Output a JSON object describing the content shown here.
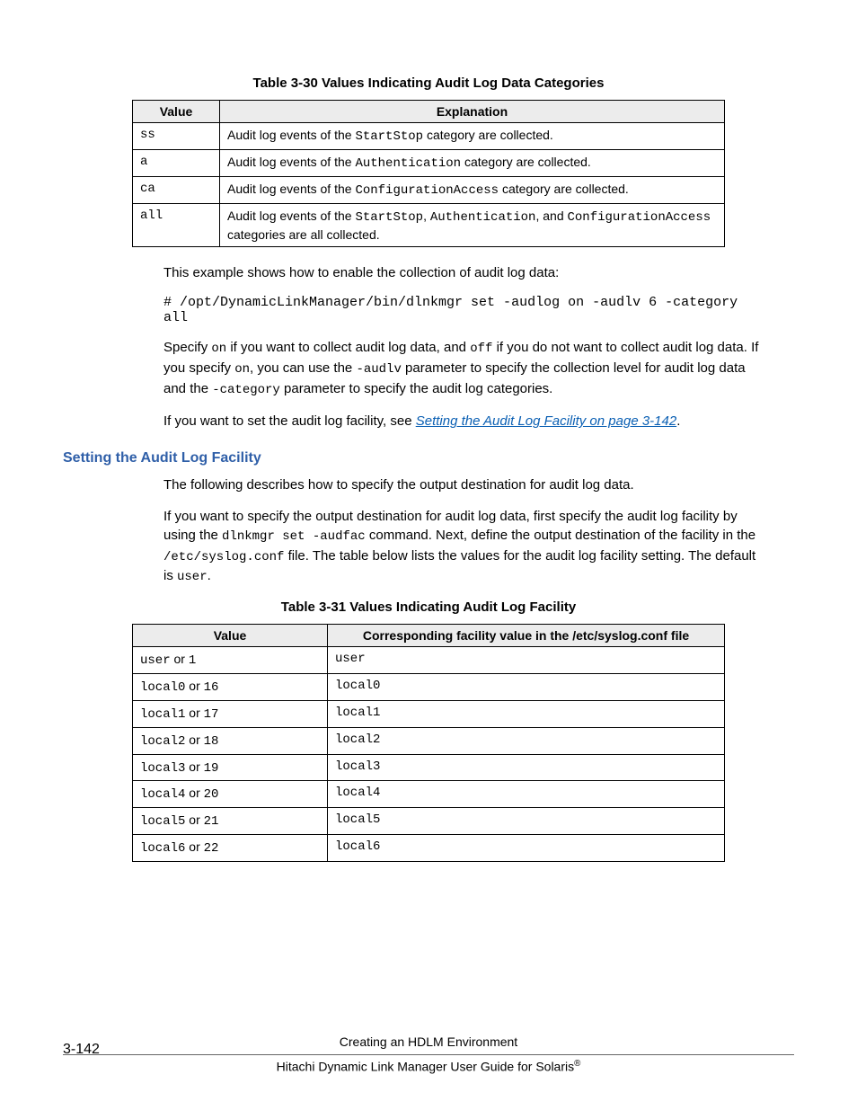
{
  "table30": {
    "caption": "Table 3-30 Values Indicating Audit Log Data Categories",
    "headers": {
      "value": "Value",
      "explanation": "Explanation"
    },
    "rows": [
      {
        "value": "ss",
        "exp_pre1": "Audit log events of the ",
        "exp_code1": "StartStop",
        "exp_post1": " category are collected."
      },
      {
        "value": "a",
        "exp_pre1": "Audit log events of the ",
        "exp_code1": "Authentication",
        "exp_post1": " category are collected."
      },
      {
        "value": "ca",
        "exp_pre1": "Audit log events of the ",
        "exp_code1": "ConfigurationAccess",
        "exp_post1": " category are collected."
      },
      {
        "value": "all",
        "exp_pre1": "Audit log events of the ",
        "exp_code1": "StartStop",
        "exp_mid1": ", ",
        "exp_code2": "Authentication",
        "exp_mid2": ", and ",
        "exp_code3": "ConfigurationAccess",
        "exp_post1": " categories are all collected."
      }
    ]
  },
  "para1": "This example shows how to enable the collection of audit log data:",
  "cmd": "# /opt/DynamicLinkManager/bin/dlnkmgr set -audlog on -audlv 6 -category all",
  "para2": {
    "p1": "Specify ",
    "c1": "on",
    "p2": " if you want to collect audit log data, and ",
    "c2": "off",
    "p3": " if you do not want to collect audit log data. If you specify ",
    "c3": "on",
    "p4": ", you can use the ",
    "c4": "-audlv",
    "p5": " parameter to specify the collection level for audit log data and the ",
    "c5": "-category",
    "p6": " parameter to specify the audit log categories."
  },
  "para3": {
    "pre": "If you want to set the audit log facility, see ",
    "link": "Setting the Audit Log Facility on page 3-142",
    "post": "."
  },
  "section_heading": "Setting the Audit Log Facility",
  "para4": "The following describes how to specify the output destination for audit log data.",
  "para5": {
    "p1": "If you want to specify the output destination for audit log data, first specify the audit log facility by using the ",
    "c1": "dlnkmgr set -audfac",
    "p2": " command. Next, define the output destination of the facility in the ",
    "c2": "/etc/syslog.conf",
    "p3": " file. The table below lists the values for the audit log facility setting. The default is ",
    "c3": "user",
    "p4": "."
  },
  "table31": {
    "caption": "Table 3-31 Values Indicating Audit Log Facility",
    "headers": {
      "value": "Value",
      "corr": "Corresponding facility value in the /etc/syslog.conf file"
    },
    "rows": [
      {
        "v1": "user",
        "or": " or ",
        "v2": "1",
        "corr": "user"
      },
      {
        "v1": "local0",
        "or": " or ",
        "v2": "16",
        "corr": "local0"
      },
      {
        "v1": "local1",
        "or": " or ",
        "v2": "17",
        "corr": "local1"
      },
      {
        "v1": "local2",
        "or": " or ",
        "v2": "18",
        "corr": "local2"
      },
      {
        "v1": "local3",
        "or": " or ",
        "v2": "19",
        "corr": "local3"
      },
      {
        "v1": "local4",
        "or": " or ",
        "v2": "20",
        "corr": "local4"
      },
      {
        "v1": "local5",
        "or": " or ",
        "v2": "21",
        "corr": "local5"
      },
      {
        "v1": "local6",
        "or": " or ",
        "v2": "22",
        "corr": "local6"
      }
    ]
  },
  "footer": {
    "page_num": "3-142",
    "line1": "Creating an HDLM Environment",
    "line2_pre": "Hitachi Dynamic Link Manager User Guide for Solaris",
    "line2_sup": "®"
  }
}
